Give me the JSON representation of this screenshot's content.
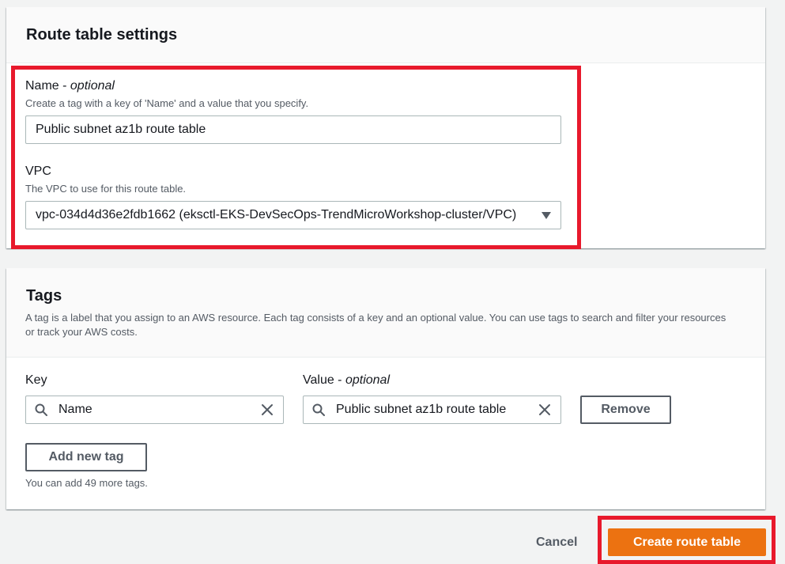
{
  "route_table_settings": {
    "title": "Route table settings",
    "name_field": {
      "label": "Name",
      "label_suffix": "optional",
      "description": "Create a tag with a key of 'Name' and a value that you specify.",
      "value": "Public subnet az1b route table"
    },
    "vpc_field": {
      "label": "VPC",
      "description": "The VPC to use for this route table.",
      "selected": "vpc-034d4d36e2fdb1662 (eksctl-EKS-DevSecOps-TrendMicroWorkshop-cluster/VPC)"
    }
  },
  "tags": {
    "title": "Tags",
    "description": "A tag is a label that you assign to an AWS resource. Each tag consists of a key and an optional value. You can use tags to search and filter your resources or track your AWS costs.",
    "key_label": "Key",
    "value_label": "Value",
    "value_label_suffix": "optional",
    "rows": [
      {
        "key": "Name",
        "value": "Public subnet az1b route table"
      }
    ],
    "remove_label": "Remove",
    "add_label": "Add new tag",
    "hint": "You can add 49 more tags."
  },
  "footer": {
    "cancel_label": "Cancel",
    "create_label": "Create route table"
  },
  "colors": {
    "highlight": "#e8192c",
    "primary": "#ec7211",
    "text": "#16191f",
    "secondary_text": "#545b64"
  },
  "icons": {
    "search": "search-icon",
    "clear": "close-icon",
    "dropdown": "caret-down-icon"
  }
}
